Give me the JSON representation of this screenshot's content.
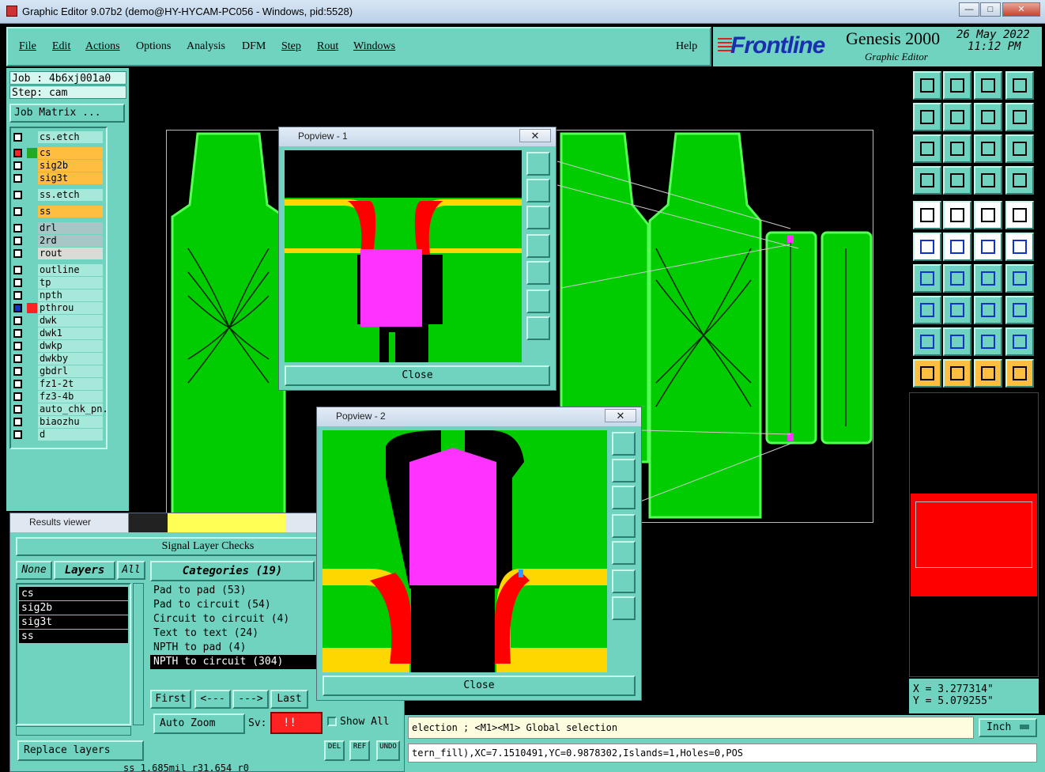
{
  "window": {
    "title": "Graphic Editor 9.07b2 (demo@HY-HYCAM-PC056 - Windows, pid:5528)",
    "min": "—",
    "max": "□",
    "close": "✕"
  },
  "menu": {
    "file": "File",
    "edit": "Edit",
    "actions": "Actions",
    "options": "Options",
    "analysis": "Analysis",
    "dfm": "DFM",
    "step": "Step",
    "rout": "Rout",
    "windows": "Windows",
    "help": "Help"
  },
  "brand": {
    "logo": "Frontline",
    "product": "Genesis 2000",
    "subtitle": "Graphic Editor",
    "date": "26 May 2022",
    "time": "11:12 PM"
  },
  "job": {
    "job": "Job : 4b6xj001a0",
    "step": "Step: cam",
    "matrix": "Job Matrix ..."
  },
  "layers": [
    "cs.etch",
    "cs",
    "sig2b",
    "sig3t",
    "ss.etch",
    "ss",
    "drl",
    "2rd",
    "rout",
    "outline",
    "tp",
    "npth",
    "pthrou",
    "dwk",
    "dwk1",
    "dwkp",
    "dwkby",
    "gbdrl",
    "fz1-2t",
    "fz3-4b",
    "auto_chk_pn.",
    "biaozhu",
    "d"
  ],
  "popview1": {
    "title": "Popview - 1",
    "close": "Close"
  },
  "popview2": {
    "title": "Popview - 2",
    "close": "Close"
  },
  "results": {
    "title": "Results viewer",
    "header": "Signal Layer Checks",
    "none": "None",
    "layers_label": "Layers",
    "all": "All",
    "categories_label": "Categories (19)",
    "layer_list": [
      "cs",
      "sig2b",
      "sig3t",
      "ss"
    ],
    "categories": [
      "Pad to pad (53)",
      "Pad to circuit (54)",
      "Circuit to circuit (4)",
      "Text to text (24)",
      "NPTH to pad (4)",
      "NPTH to circuit (304)"
    ],
    "first": "First",
    "prev": "<---",
    "next": "--->",
    "last": "Last",
    "zoom": "Auto Zoom",
    "sv": "Sv:",
    "sv_value": "!!",
    "show_all": "Show All",
    "replace": "Replace layers",
    "del": "DEL",
    "ref": "REF",
    "undo": "UNDO",
    "status_bottom": "ss 1.685mil  r31.654  r0"
  },
  "status": {
    "line1": "election ; <M1><M1> Global selection",
    "line2": "tern_fill),XC=7.1510491,YC=0.9878302,Islands=1,Holes=0,POS",
    "units": "Inch"
  },
  "coords": {
    "x": "X = 3.277314\"",
    "y": "Y = 5.079255\""
  },
  "toolbar_icons": [
    "zoom-in-icon",
    "zoom-out-icon",
    "home-icon",
    "grid-icon",
    "pan-left-icon",
    "pan-right-icon",
    "back-icon",
    "redraw-icon",
    "fit-icon",
    "zoom-center-icon",
    "one-to-one-icon",
    "help-icon",
    "settings-icon",
    "grid-toggle-icon",
    "layer-red-icon",
    "layer-red2-icon"
  ],
  "colors": {
    "teal": "#6fd3c0",
    "green": "#00cc00",
    "magenta": "#ff33ff",
    "yellow": "#ffd700",
    "red": "#ff0000"
  }
}
